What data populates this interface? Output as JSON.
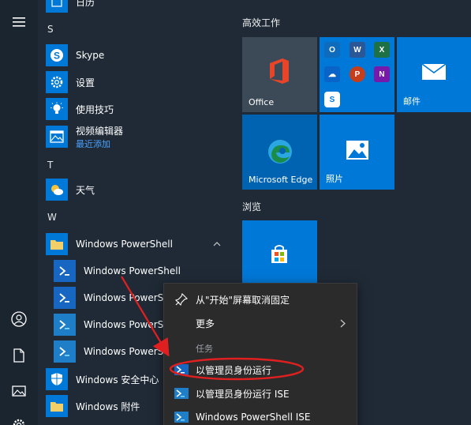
{
  "applist": {
    "top_partial": "日历",
    "sections": [
      {
        "letter": "S"
      },
      {
        "letter": "T"
      },
      {
        "letter": "W"
      }
    ],
    "items": {
      "skype": "Skype",
      "settings": "设置",
      "tips": "使用技巧",
      "video_editor": "视频编辑器",
      "video_editor_sub": "最近添加",
      "weather": "天气",
      "powershell_folder": "Windows PowerShell",
      "ps1": "Windows PowerShell",
      "ps2": "Windows PowerSh",
      "ps3": "Windows PowerSh",
      "ps4": "Windows PowerSh",
      "security": "Windows 安全中心",
      "accessories": "Windows 附件"
    }
  },
  "tiles": {
    "group1": "高效工作",
    "office": "Office",
    "mail": "邮件",
    "edge": "Microsoft Edge",
    "photos": "照片",
    "group2": "浏览"
  },
  "context_menu": {
    "unpin": "从\"开始\"屏幕取消固定",
    "more": "更多",
    "section": "任务",
    "run_admin": "以管理员身份运行",
    "run_admin_ise": "以管理员身份运行 ISE",
    "ps_ise": "Windows PowerShell ISE"
  },
  "colors": {
    "background": "#1f2a36",
    "tile_blue": "#0078d7",
    "tile_gray": "#3c4a58",
    "annotation_red": "#e02020"
  },
  "icons": [
    "hamburger-icon",
    "user-icon",
    "document-icon",
    "pictures-icon",
    "settings-icon",
    "skype-icon",
    "gear-icon",
    "lightbulb-icon",
    "film-icon",
    "weather-icon",
    "folder-icon",
    "powershell-icon",
    "shield-icon",
    "office-icon",
    "mail-icon",
    "edge-icon",
    "photos-icon",
    "store-icon",
    "unpin-icon",
    "chevron-right-icon",
    "chevron-up-icon"
  ]
}
